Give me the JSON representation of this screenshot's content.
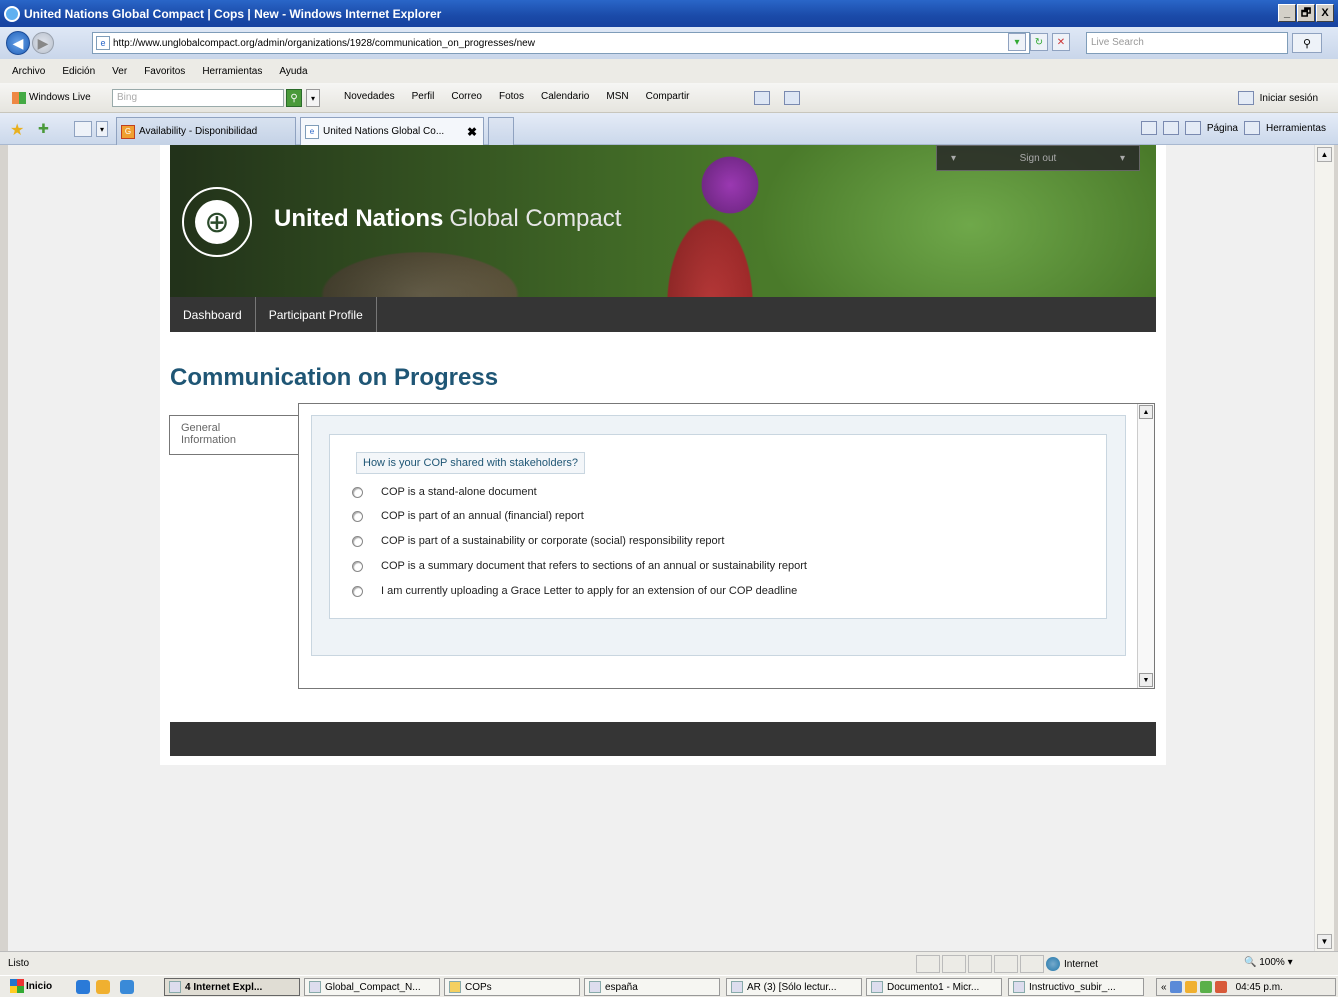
{
  "window": {
    "title": "United Nations Global Compact | Cops | New - Windows Internet Explorer",
    "min": "_",
    "max": "🗗",
    "close": "X"
  },
  "address": {
    "url": "http://www.unglobalcompact.org/admin/organizations/1928/communication_on_progresses/new",
    "search_placeholder": "Live Search"
  },
  "menu": [
    "Archivo",
    "Edición",
    "Ver",
    "Favoritos",
    "Herramientas",
    "Ayuda"
  ],
  "livebar": {
    "label": "Windows Live",
    "search_placeholder": "Bing",
    "links": [
      "Novedades",
      "Perfil",
      "Correo",
      "Fotos",
      "Calendario",
      "MSN",
      "Compartir"
    ],
    "signin": "Iniciar sesión"
  },
  "tabs": [
    {
      "label": "Availability - Disponibilidad",
      "active": false
    },
    {
      "label": "United Nations Global Co...",
      "active": true
    }
  ],
  "commandbar": {
    "page": "Página",
    "tools": "Herramientas"
  },
  "site": {
    "brand_bold": "United Nations",
    "brand_light": "Global Compact",
    "signout": "Sign out",
    "nav": [
      "Dashboard",
      "Participant Profile"
    ],
    "page_title": "Communication on Progress",
    "side_tab": "General\nInformation",
    "question": "How is your COP shared with stakeholders?",
    "options": [
      "COP is a stand-alone document",
      "COP is part of an annual (financial) report",
      "COP is part of a sustainability or corporate (social) responsibility report",
      "COP is a summary document that refers to sections of an annual or sustainability report",
      "I am currently uploading a Grace Letter to apply for an extension of our COP deadline"
    ]
  },
  "status": {
    "text": "Listo",
    "zone": "Internet",
    "zoom": "100%"
  },
  "taskbar": {
    "start": "Inicio",
    "items": [
      "4 Internet Expl...",
      "Global_Compact_N...",
      "COPs",
      "españa",
      "AR (3) [Sólo lectur...",
      "Documento1 - Micr...",
      "Instructivo_subir_..."
    ],
    "clock": "04:45 p.m."
  }
}
